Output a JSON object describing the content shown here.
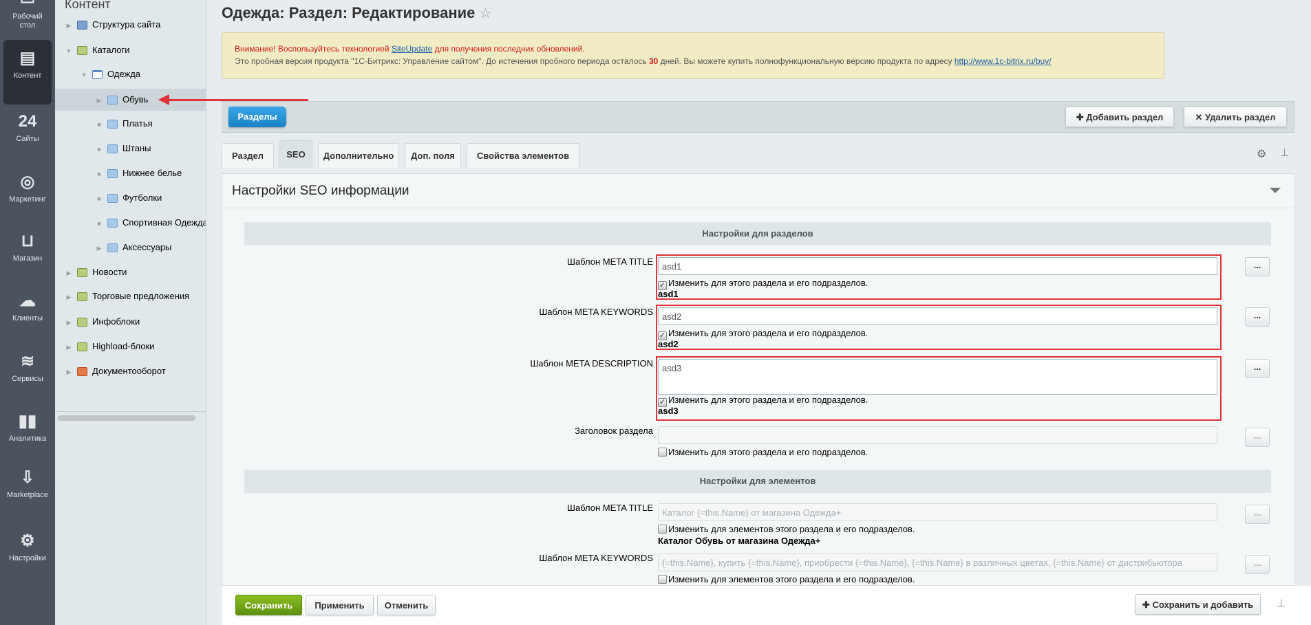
{
  "nav": [
    {
      "label": "Рабочий стол",
      "icon": "desktop-icon"
    },
    {
      "label": "Контент",
      "icon": "document-icon",
      "active": true
    },
    {
      "label": "Сайты",
      "icon": "calendar-24-icon"
    },
    {
      "label": "Маркетинг",
      "icon": "target-icon"
    },
    {
      "label": "Магазин",
      "icon": "basket-icon"
    },
    {
      "label": "Клиенты",
      "icon": "cloud-24-icon"
    },
    {
      "label": "Сервисы",
      "icon": "layers-icon"
    },
    {
      "label": "Аналитика",
      "icon": "bar-chart-icon"
    },
    {
      "label": "Marketplace",
      "icon": "cloud-download-icon"
    },
    {
      "label": "Настройки",
      "icon": "gear-icon"
    }
  ],
  "tree": {
    "header": "Контент",
    "items": [
      {
        "label": "Структура сайта",
        "level": 0,
        "expander": "collapsed",
        "icon": "structure"
      },
      {
        "label": "Каталоги",
        "level": 0,
        "expander": "expanded",
        "icon": "green"
      },
      {
        "label": "Одежда",
        "level": 1,
        "expander": "expanded",
        "icon": "cal"
      },
      {
        "label": "Обувь",
        "level": 2,
        "expander": "collapsed",
        "icon": "folder",
        "selected": true
      },
      {
        "label": "Платья",
        "level": 2,
        "expander": "leaf",
        "icon": "folder"
      },
      {
        "label": "Штаны",
        "level": 2,
        "expander": "leaf",
        "icon": "folder"
      },
      {
        "label": "Нижнее белье",
        "level": 2,
        "expander": "leaf",
        "icon": "folder"
      },
      {
        "label": "Футболки",
        "level": 2,
        "expander": "leaf",
        "icon": "folder"
      },
      {
        "label": "Спортивная Одежда",
        "level": 2,
        "expander": "leaf",
        "icon": "folder"
      },
      {
        "label": "Аксессуары",
        "level": 2,
        "expander": "collapsed",
        "icon": "folder"
      },
      {
        "label": "Новости",
        "level": 0,
        "expander": "collapsed",
        "icon": "green"
      },
      {
        "label": "Торговые предложения",
        "level": 0,
        "expander": "collapsed",
        "icon": "green"
      },
      {
        "label": "Инфоблоки",
        "level": 0,
        "expander": "collapsed",
        "icon": "green"
      },
      {
        "label": "Highload-блоки",
        "level": 0,
        "expander": "collapsed",
        "icon": "green"
      },
      {
        "label": "Документооборот",
        "level": 0,
        "expander": "collapsed",
        "icon": "doc"
      }
    ]
  },
  "page": {
    "title": "Одежда: Раздел: Редактирование"
  },
  "notice": {
    "warn_prefix": "Внимание! Воспользуйтесь технологией ",
    "warn_link": "SiteUpdate",
    "warn_suffix": " для получения последних обновлений.",
    "trial_prefix": "Это пробная версия продукта \"1С-Битрикс: Управление сайтом\". До истечения пробного периода осталось ",
    "days": "30",
    "trial_mid": " дней. Вы можете купить полнофункциональную версию продукта по адресу ",
    "trial_link": "http://www.1c-bitrix.ru/buy/"
  },
  "toolbar": {
    "back": "Разделы",
    "add": "Добавить раздел",
    "delete": "Удалить раздел"
  },
  "tabs": [
    "Раздел",
    "SEO",
    "Дополнительно",
    "Доп. поля",
    "Свойства элементов"
  ],
  "active_tab": "SEO",
  "panel": {
    "title": "Настройки SEO информации",
    "sections_header": "Настройки для разделов",
    "elements_header": "Настройки для элементов",
    "section_rows": [
      {
        "label": "Шаблон META TITLE",
        "value": "asd1",
        "checkbox": "Изменить для этого раздела и его подразделов.",
        "checked": true,
        "preview": "asd1"
      },
      {
        "label": "Шаблон META KEYWORDS",
        "value": "asd2",
        "checkbox": "Изменить для этого раздела и его подразделов.",
        "checked": true,
        "preview": "asd2"
      },
      {
        "label": "Шаблон META DESCRIPTION",
        "value": "asd3",
        "checkbox": "Изменить для этого раздела и его подразделов.",
        "checked": true,
        "preview": "asd3"
      },
      {
        "label": "Заголовок раздела",
        "value": "",
        "checkbox": "Изменить для этого раздела и его подразделов.",
        "checked": false
      }
    ],
    "element_rows": [
      {
        "label": "Шаблон META TITLE",
        "placeholder": "Каталог {=this.Name} от магазина Одежда+",
        "checkbox": "Изменить для элементов этого раздела и его подразделов.",
        "checked": false,
        "preview": "Каталог Обувь от магазина Одежда+"
      },
      {
        "label": "Шаблон META KEYWORDS",
        "placeholder": "{=this.Name}, купить {=this.Name}, приобрести {=this.Name}, {=this.Name} в различных цветах, {=this.Name} от дистрибьютора",
        "checkbox": "Изменить для элементов этого раздела и его подразделов.",
        "checked": false
      }
    ],
    "dots": "..."
  },
  "footer": {
    "save": "Сохранить",
    "apply": "Применить",
    "cancel": "Отменить",
    "save_add": "Сохранить и добавить"
  },
  "colors": {
    "annotation": "#e0333a",
    "save_green": "#6a9a10",
    "back_blue": "#1d8fd3",
    "notice_bg": "#f1ecc4"
  }
}
